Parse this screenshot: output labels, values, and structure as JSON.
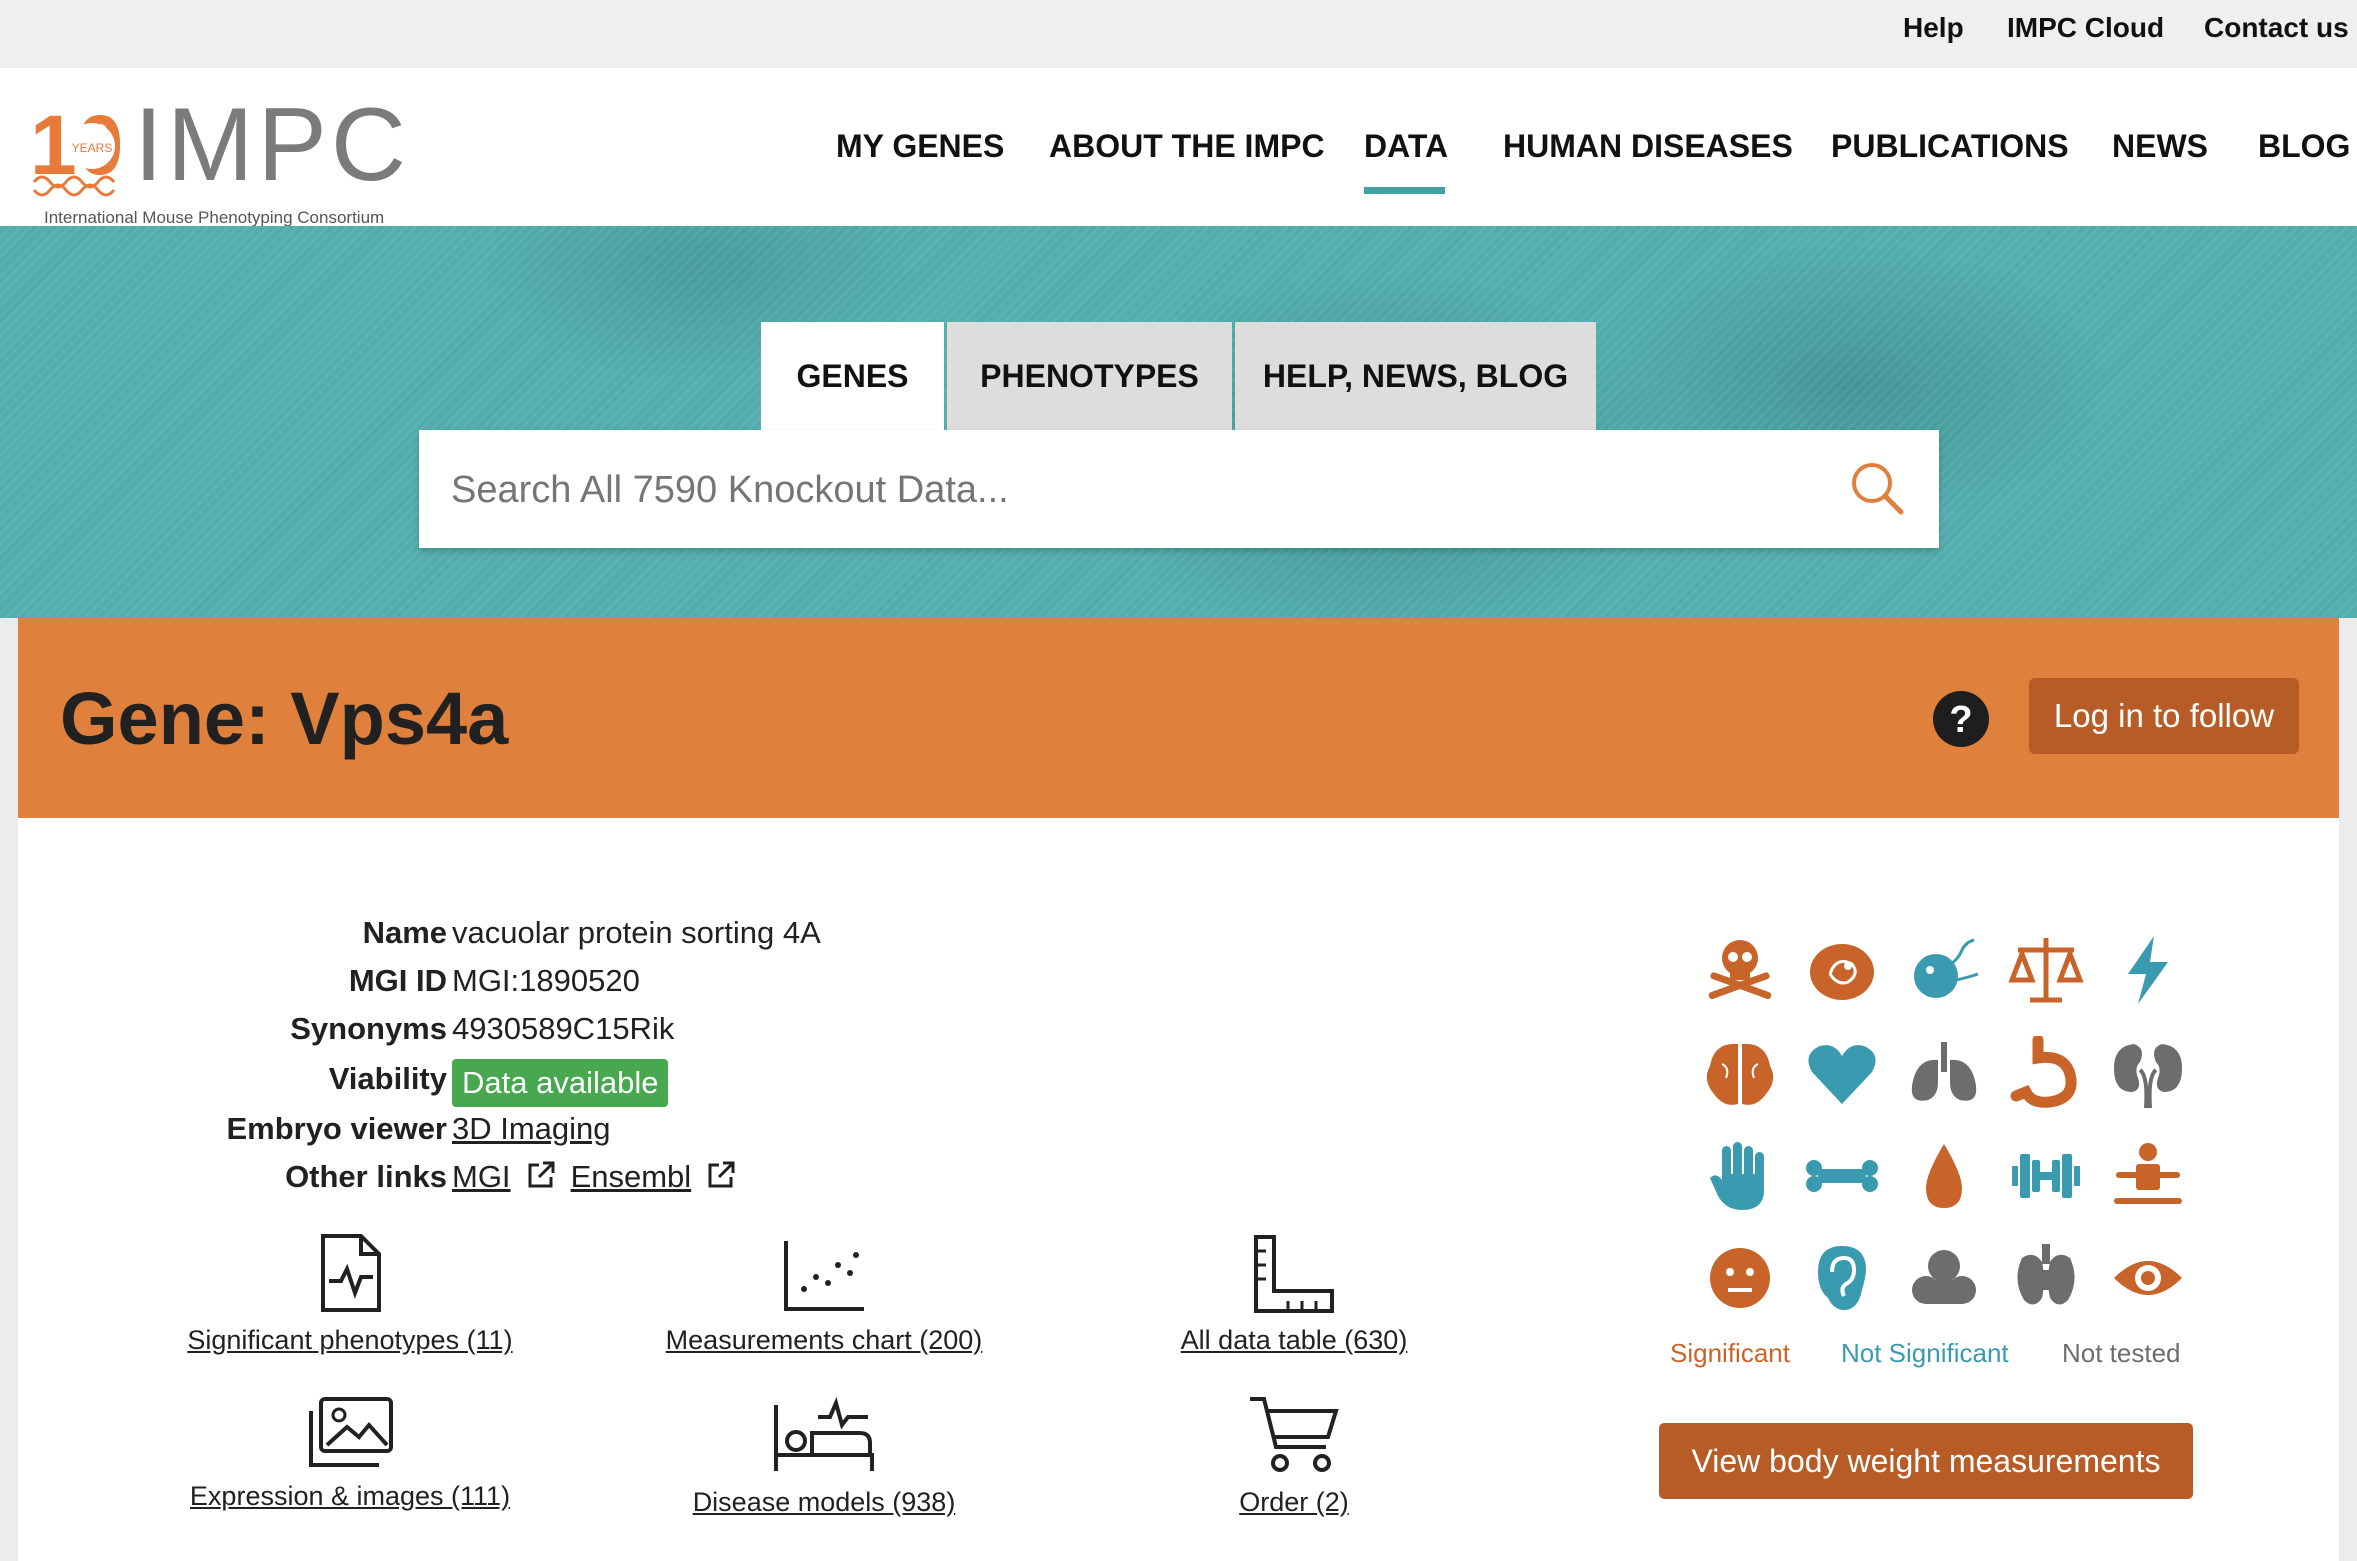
{
  "utility_links": {
    "help": "Help",
    "cloud": "IMPC Cloud",
    "contact": "Contact us"
  },
  "logo": {
    "years_number": "10",
    "years_label": "YEARS",
    "wordmark": "IMPC",
    "subtitle": "International Mouse Phenotyping Consortium"
  },
  "nav": {
    "my_genes": "MY GENES",
    "about": "ABOUT THE IMPC",
    "data": "DATA",
    "human_diseases": "HUMAN DISEASES",
    "publications": "PUBLICATIONS",
    "news": "NEWS",
    "blog": "BLOG",
    "active": "DATA"
  },
  "search": {
    "tabs": {
      "genes": "GENES",
      "phenotypes": "PHENOTYPES",
      "help_news_blog": "HELP, NEWS, BLOG"
    },
    "active_tab": "GENES",
    "placeholder": "Search All 7590 Knockout Data..."
  },
  "gene": {
    "title": "Gene: Vps4a",
    "follow_button": "Log in to follow"
  },
  "details": {
    "name_label": "Name",
    "name": "vacuolar protein sorting 4A",
    "mgi_label": "MGI ID",
    "mgi_id": "MGI:1890520",
    "synonyms_label": "Synonyms",
    "synonyms": "4930589C15Rik",
    "viability_label": "Viability",
    "viability": "Data available",
    "embryo_label": "Embryo viewer",
    "embryo_link": "3D Imaging",
    "other_label": "Other links",
    "mgi_link": "MGI",
    "ensembl_link": "Ensembl"
  },
  "summary_links": {
    "significant_phenotypes": "Significant phenotypes (11)",
    "measurements_chart": "Measurements chart (200)",
    "all_data_table": "All data table (630)",
    "expression_images": "Expression & images (111)",
    "disease_models": "Disease models (938)",
    "order": "Order (2)"
  },
  "colors": {
    "significant": "#c8642a",
    "not_significant": "#3a9ab0",
    "not_tested": "#6d6d6d",
    "banner": "#e0803d",
    "accent": "#43a1a4",
    "viability_badge": "#47a84f"
  },
  "physiological_systems": [
    {
      "icon": "skull-crossbones-icon",
      "status": "significant"
    },
    {
      "icon": "embryo-icon",
      "status": "significant"
    },
    {
      "icon": "reproductive-system-icon",
      "status": "not_significant"
    },
    {
      "icon": "scales-icon",
      "status": "significant"
    },
    {
      "icon": "lightning-icon",
      "status": "not_significant"
    },
    {
      "icon": "brain-icon",
      "status": "significant"
    },
    {
      "icon": "heart-icon",
      "status": "not_significant"
    },
    {
      "icon": "lungs-icon",
      "status": "not_tested"
    },
    {
      "icon": "stomach-icon",
      "status": "significant"
    },
    {
      "icon": "kidneys-icon",
      "status": "not_tested"
    },
    {
      "icon": "hand-icon",
      "status": "not_significant"
    },
    {
      "icon": "bone-icon",
      "status": "not_significant"
    },
    {
      "icon": "blood-drop-icon",
      "status": "significant"
    },
    {
      "icon": "dumbbell-icon",
      "status": "not_significant"
    },
    {
      "icon": "body-figure-icon",
      "status": "significant"
    },
    {
      "icon": "face-icon",
      "status": "significant"
    },
    {
      "icon": "ear-icon",
      "status": "not_significant"
    },
    {
      "icon": "nose-icon",
      "status": "not_tested"
    },
    {
      "icon": "thyroid-icon",
      "status": "not_tested"
    },
    {
      "icon": "eye-icon",
      "status": "significant"
    }
  ],
  "legend": {
    "significant": "Significant",
    "not_significant": "Not Significant",
    "not_tested": "Not tested"
  },
  "body_weight_button": "View body weight measurements"
}
